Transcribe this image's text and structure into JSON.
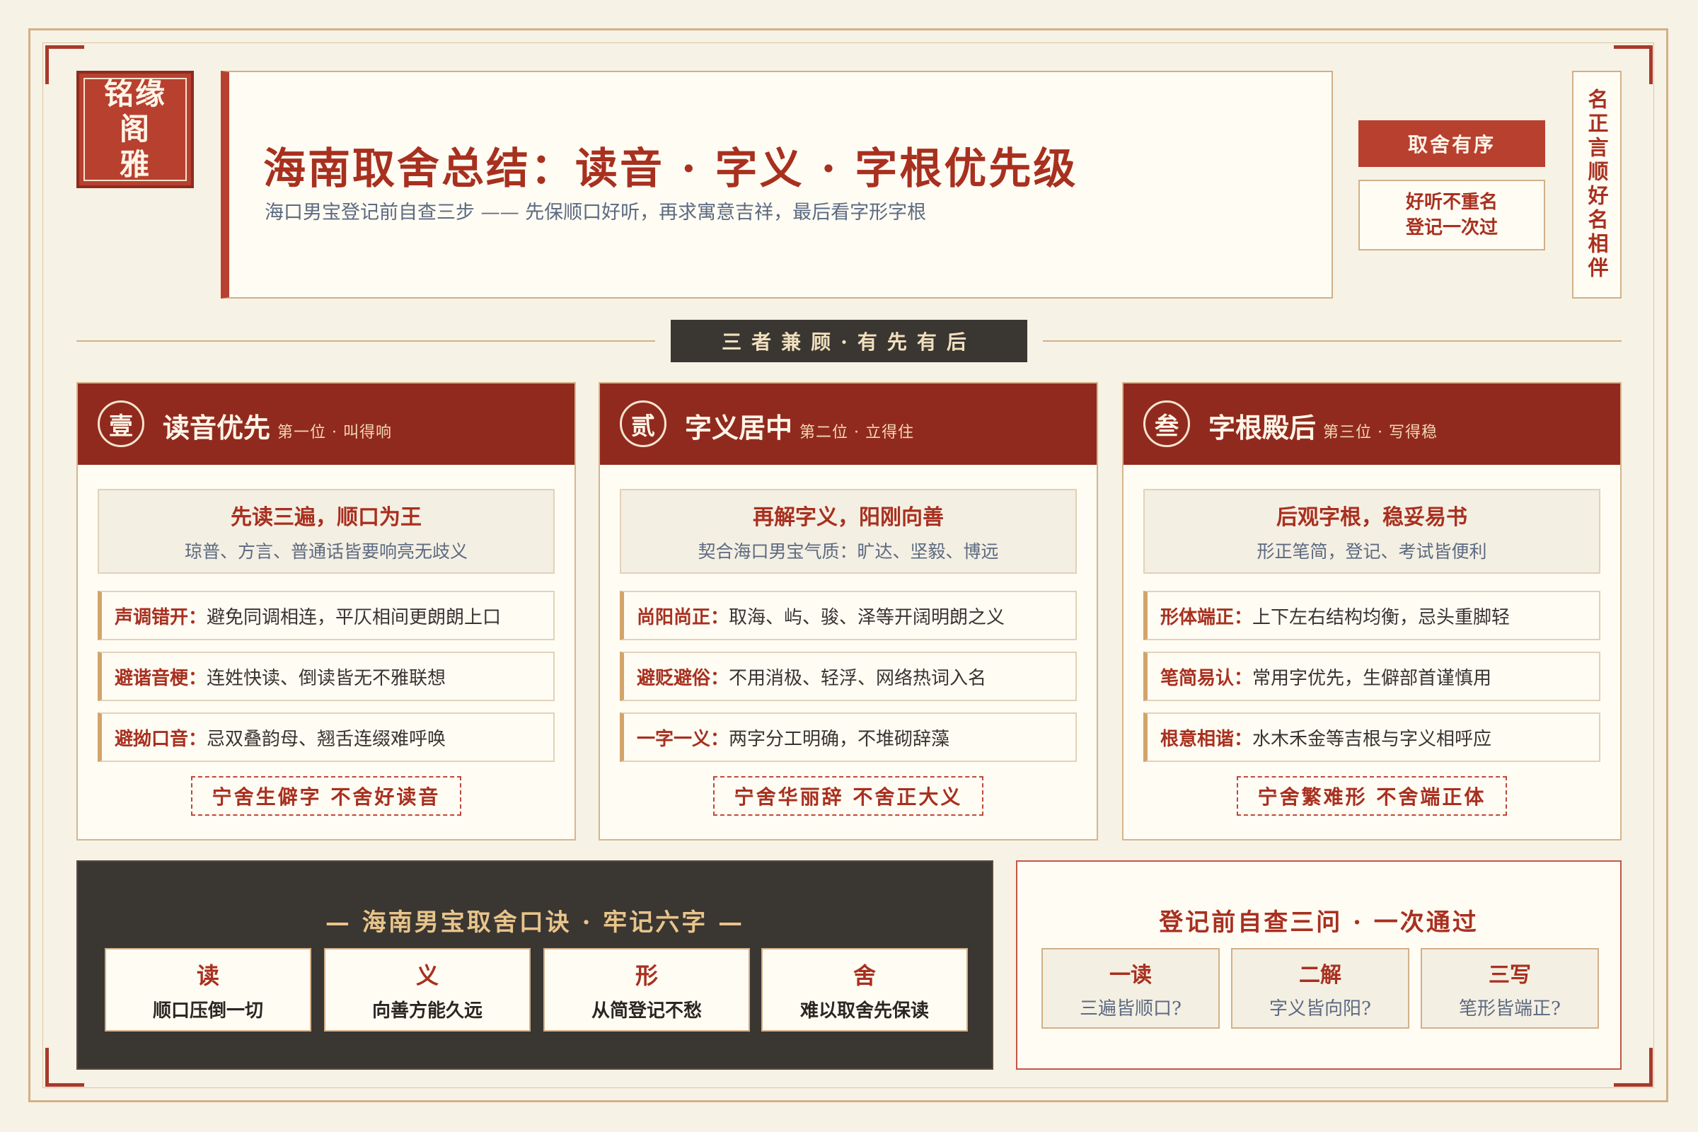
{
  "seal": {
    "line1": "铭缘阁",
    "line2": "雅"
  },
  "header": {
    "title": "海南取舍总结：读音 · 字义 · 字根优先级",
    "subtitle": "海口男宝登记前自查三步 —— 先保顺口好听，再求寓意吉祥，最后看字形字根"
  },
  "side": {
    "tag": "取舍有序",
    "note_line1": "好听不重名",
    "note_line2": "登记一次过",
    "vertical": "名正言顺好名相伴"
  },
  "divider": "三者兼顾·有先有后",
  "cards": [
    {
      "num": "壹",
      "title": "读音优先",
      "subtitle": "第一位 · 叫得响",
      "lead_title": "先读三遍，顺口为王",
      "lead_sub": "琼普、方言、普通话皆要响亮无歧义",
      "rows": [
        {
          "key": "声调错开：",
          "val": "避免同调相连，平仄相间更朗朗上口"
        },
        {
          "key": "避谐音梗：",
          "val": "连姓快读、倒读皆无不雅联想"
        },
        {
          "key": "避拗口音：",
          "val": "忌双叠韵母、翘舌连缀难呼唤"
        }
      ],
      "motto": "宁舍生僻字 不舍好读音"
    },
    {
      "num": "贰",
      "title": "字义居中",
      "subtitle": "第二位 · 立得住",
      "lead_title": "再解字义，阳刚向善",
      "lead_sub": "契合海口男宝气质：旷达、坚毅、博远",
      "rows": [
        {
          "key": "尚阳尚正：",
          "val": "取海、屿、骏、泽等开阔明朗之义"
        },
        {
          "key": "避贬避俗：",
          "val": "不用消极、轻浮、网络热词入名"
        },
        {
          "key": "一字一义：",
          "val": "两字分工明确，不堆砌辞藻"
        }
      ],
      "motto": "宁舍华丽辞 不舍正大义"
    },
    {
      "num": "叁",
      "title": "字根殿后",
      "subtitle": "第三位 · 写得稳",
      "lead_title": "后观字根，稳妥易书",
      "lead_sub": "形正笔简，登记、考试皆便利",
      "rows": [
        {
          "key": "形体端正：",
          "val": "上下左右结构均衡，忌头重脚轻"
        },
        {
          "key": "笔简易认：",
          "val": "常用字优先，生僻部首谨慎用"
        },
        {
          "key": "根意相谐：",
          "val": "水木禾金等吉根与字义相呼应"
        }
      ],
      "motto": "宁舍繁难形 不舍端正体"
    }
  ],
  "mnemonic": {
    "title": "— 海南男宝取舍口诀 · 牢记六字 —",
    "items": [
      {
        "char": "读",
        "desc": "顺口压倒一切"
      },
      {
        "char": "义",
        "desc": "向善方能久远"
      },
      {
        "char": "形",
        "desc": "从简登记不愁"
      },
      {
        "char": "舍",
        "desc": "难以取舍先保读"
      }
    ]
  },
  "checklist": {
    "title": "登记前自查三问 · 一次通过",
    "items": [
      {
        "head": "一读",
        "q": "三遍皆顺口?"
      },
      {
        "head": "二解",
        "q": "字义皆向阳?"
      },
      {
        "head": "三写",
        "q": "笔形皆端正?"
      }
    ]
  },
  "colors": {
    "accent_red": "#b8402f",
    "header_red": "#912a1e",
    "dark": "#3a3632",
    "gold_border": "#d2b088"
  }
}
